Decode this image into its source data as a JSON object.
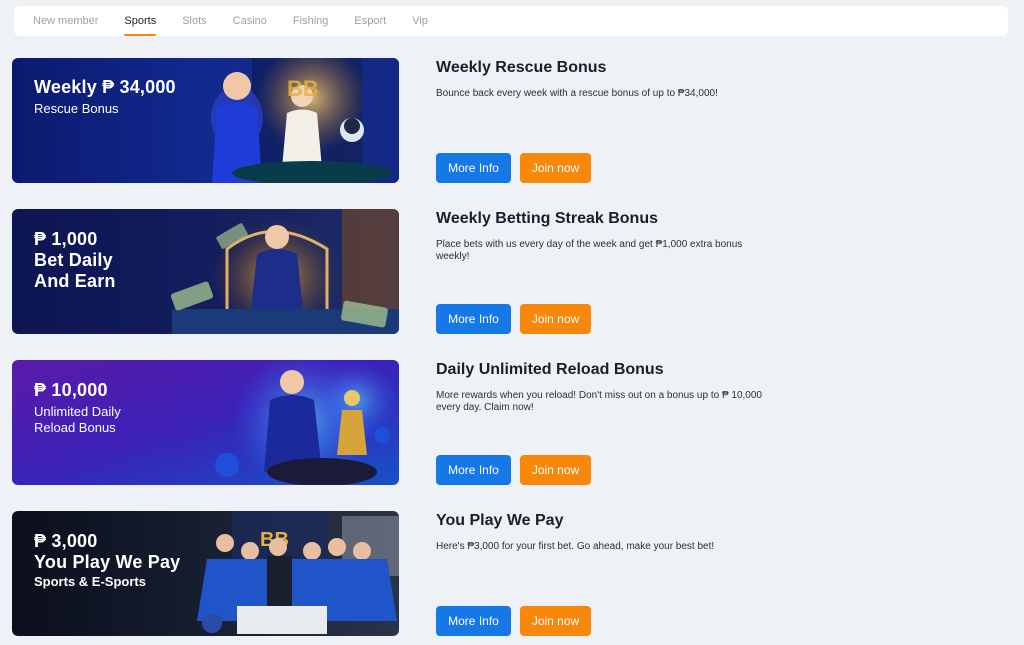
{
  "tabs": [
    {
      "label": "New member",
      "active": false
    },
    {
      "label": "Sports",
      "active": true
    },
    {
      "label": "Slots",
      "active": false
    },
    {
      "label": "Casino",
      "active": false
    },
    {
      "label": "Fishing",
      "active": false
    },
    {
      "label": "Esport",
      "active": false
    },
    {
      "label": "Vip",
      "active": false
    }
  ],
  "colors": {
    "accent_blue": "#1677e6",
    "accent_orange": "#f7880c"
  },
  "promos": [
    {
      "banner": {
        "line1": "Weekly ₱ 34,000",
        "line2": "Rescue Bonus",
        "logo": "BB"
      },
      "title": "Weekly Rescue Bonus",
      "description": "Bounce back every week with a rescue bonus of up to ₱34,000!",
      "more_label": "More Info",
      "join_label": "Join now"
    },
    {
      "banner": {
        "line1": "₱ 1,000",
        "line2": "Bet Daily",
        "line3": "And Earn"
      },
      "title": "Weekly Betting Streak Bonus",
      "description": "Place bets with us every day of the week and get ₱1,000 extra bonus weekly!",
      "more_label": "More Info",
      "join_label": "Join now"
    },
    {
      "banner": {
        "line1": "₱ 10,000",
        "line2": "Unlimited Daily",
        "line3": "Reload Bonus"
      },
      "title": "Daily Unlimited Reload Bonus",
      "description": "More rewards when you reload! Don't miss out on a bonus up to ₱ 10,000 every day. Claim now!",
      "more_label": "More Info",
      "join_label": "Join now"
    },
    {
      "banner": {
        "line1": "₱ 3,000",
        "line2": "You Play We Pay",
        "line3": "Sports & E-Sports",
        "logo": "BB"
      },
      "title": "You Play We Pay",
      "description": "Here's ₱3,000 for your first bet. Go ahead, make your best bet!",
      "more_label": "More Info",
      "join_label": "Join now"
    }
  ]
}
